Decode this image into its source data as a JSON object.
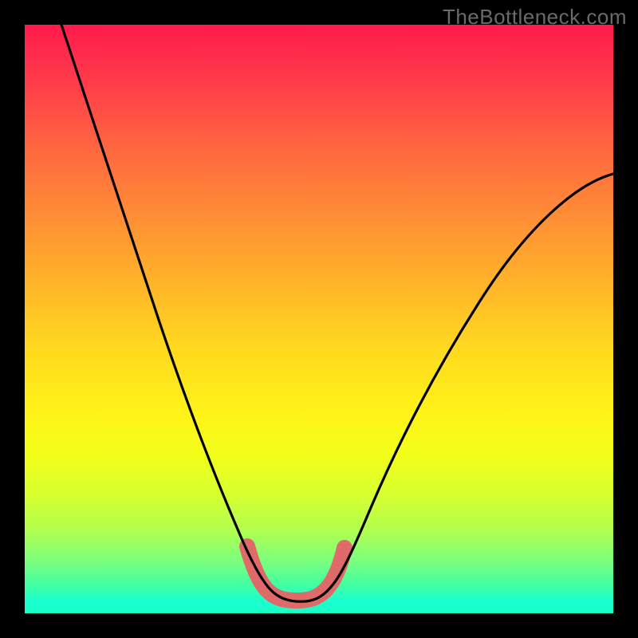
{
  "watermark": "TheBottleneck.com",
  "chart_data": {
    "type": "line",
    "title": "",
    "xlabel": "",
    "ylabel": "",
    "xlim": [
      0,
      100
    ],
    "ylim": [
      0,
      100
    ],
    "grid": false,
    "series": [
      {
        "name": "bottleneck-curve",
        "x": [
          6,
          10,
          14,
          18,
          22,
          26,
          30,
          34,
          36,
          38,
          40,
          43,
          46,
          49,
          51,
          53,
          56,
          60,
          64,
          68,
          72,
          76,
          80,
          84,
          88,
          92,
          96,
          100
        ],
        "y": [
          100,
          90,
          80,
          70,
          60,
          50,
          40,
          28,
          22,
          16,
          10,
          5,
          3,
          3,
          5,
          10,
          16,
          24,
          31,
          38,
          44,
          50,
          55,
          60,
          64,
          68,
          71,
          74
        ]
      },
      {
        "name": "optimal-band",
        "x": [
          38,
          40,
          42,
          44,
          46,
          48,
          50,
          52,
          54
        ],
        "y": [
          11,
          7,
          4.5,
          3.2,
          3,
          3.2,
          4.2,
          7,
          11
        ]
      }
    ],
    "colors": {
      "curve": "#000000",
      "optimal_band": "#e06a6a",
      "gradient_top": "#ff1a4d",
      "gradient_bottom": "#17ffc6"
    }
  }
}
